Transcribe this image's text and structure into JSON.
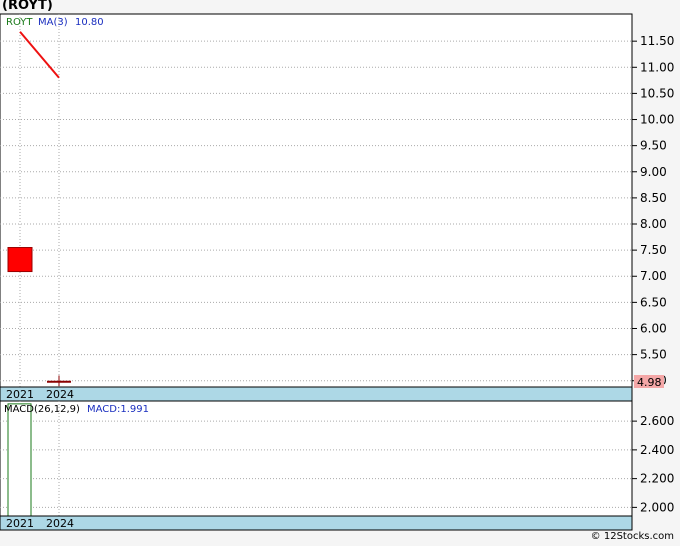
{
  "header": {
    "title": "(ROYT)"
  },
  "footer": {
    "credit": "© 12Stocks.com"
  },
  "chart_data": [
    {
      "type": "candlestick",
      "panel": "price",
      "ticker_label": "ROYT",
      "ma_label": "MA(3)",
      "ma_value": "10.80",
      "x": [
        "2021",
        "2024"
      ],
      "candles": [
        {
          "x": "2021",
          "open": 7.55,
          "close": 7.09,
          "high": 7.55,
          "low": 7.09,
          "color": "#ff0000"
        },
        {
          "x": "2024",
          "open": 4.98,
          "close": 4.98,
          "high": 5.1,
          "low": 4.9,
          "color": "#8b0000"
        }
      ],
      "ma_series": {
        "name": "MA(3)",
        "color": "#ee1111",
        "points": [
          {
            "x": "2021",
            "y": 11.68
          },
          {
            "x": "2024",
            "y": 10.8
          }
        ]
      },
      "ylim": [
        4.88,
        12.02
      ],
      "y_ticks": [
        11.5,
        11.0,
        10.5,
        10.0,
        9.5,
        9.0,
        8.5,
        8.0,
        7.5,
        7.0,
        6.5,
        6.0,
        5.5,
        5.0
      ],
      "y_tick_labels": [
        "11.50",
        "11.00",
        "10.50",
        "10.00",
        "9.50",
        "9.00",
        "8.50",
        "8.00",
        "7.50",
        "7.00",
        "6.50",
        "6.00",
        "5.50",
        "5.00"
      ],
      "last_price": "4.98",
      "last_price_color": "#f4a7a7",
      "grid": true
    },
    {
      "type": "bar",
      "panel": "macd",
      "macd_label": "MACD(26,12,9)",
      "macd_value_label": "MACD:1.991",
      "categories": [
        "2021",
        "2024"
      ],
      "values": [
        2.72,
        null
      ],
      "ylim": [
        1.94,
        2.74
      ],
      "y_ticks": [
        2.6,
        2.4,
        2.2,
        2.0
      ],
      "y_tick_labels": [
        "2.600",
        "2.400",
        "2.200",
        "2.000"
      ],
      "grid": true
    }
  ],
  "colors": {
    "axis_band": "#add8e6",
    "grid": "#aaaaaa",
    "macd_bar_stroke": "#1a7a1a"
  }
}
